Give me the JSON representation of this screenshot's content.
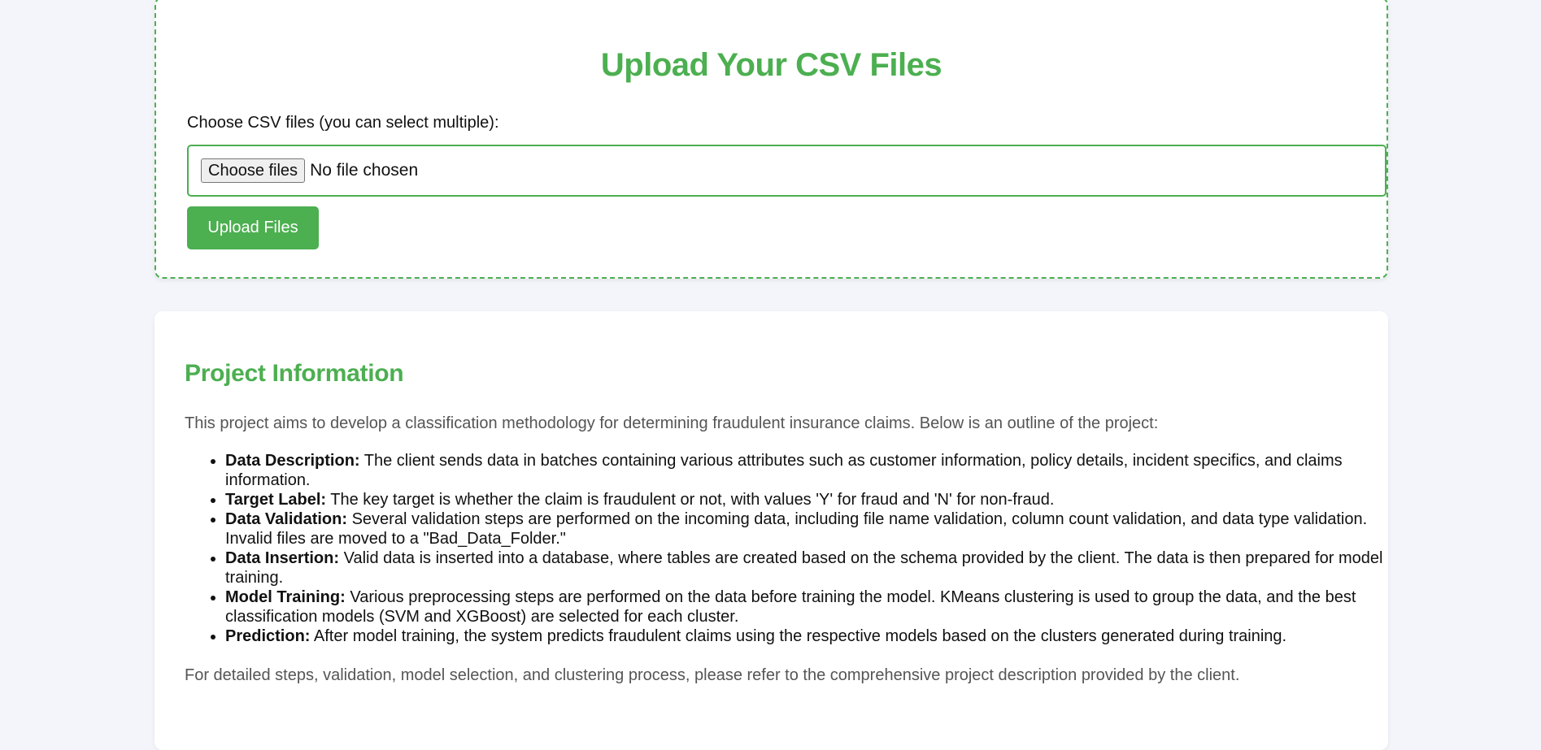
{
  "upload": {
    "title": "Upload Your CSV Files",
    "file_label": "Choose CSV files (you can select multiple):",
    "choose_button": "Choose files",
    "no_file_text": "No file chosen",
    "upload_button": "Upload Files"
  },
  "project": {
    "title": "Project Information",
    "intro": "This project aims to develop a classification methodology for determining fraudulent insurance claims. Below is an outline of the project:",
    "items": [
      {
        "label": "Data Description:",
        "text": " The client sends data in batches containing various attributes such as customer information, policy details, incident specifics, and claims information."
      },
      {
        "label": "Target Label:",
        "text": " The key target is whether the claim is fraudulent or not, with values 'Y' for fraud and 'N' for non-fraud."
      },
      {
        "label": "Data Validation:",
        "text": " Several validation steps are performed on the incoming data, including file name validation, column count validation, and data type validation. Invalid files are moved to a \"Bad_Data_Folder.\""
      },
      {
        "label": "Data Insertion:",
        "text": " Valid data is inserted into a database, where tables are created based on the schema provided by the client. The data is then prepared for model training."
      },
      {
        "label": "Model Training:",
        "text": " Various preprocessing steps are performed on the data before training the model. KMeans clustering is used to group the data, and the best classification models (SVM and XGBoost) are selected for each cluster."
      },
      {
        "label": "Prediction:",
        "text": " After model training, the system predicts fraudulent claims using the respective models based on the clusters generated during training."
      }
    ],
    "outro": "For detailed steps, validation, model selection, and clustering process, please refer to the comprehensive project description provided by the client."
  },
  "colors": {
    "accent": "#4caf50",
    "background": "#f3f5fa"
  }
}
